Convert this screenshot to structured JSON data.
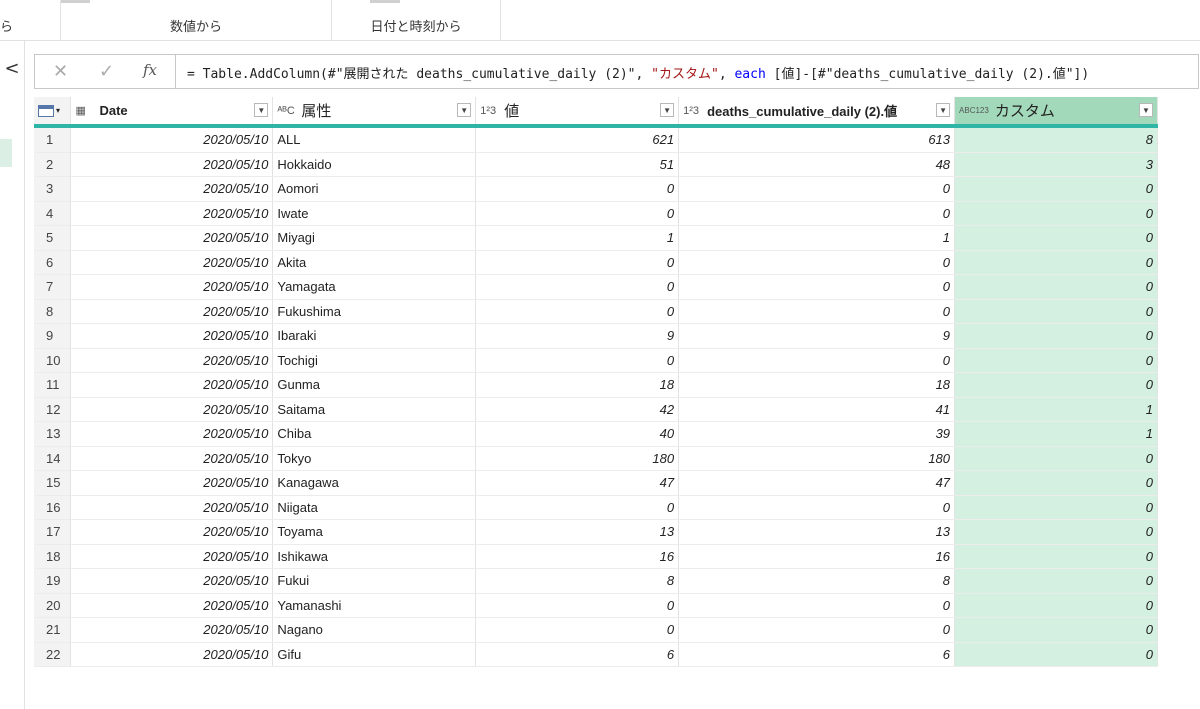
{
  "ribbon": {
    "left_fragment": "ら",
    "groups": [
      "数値から",
      "日付と時刻から"
    ]
  },
  "left_pane": {
    "collapse_glyph": "<"
  },
  "formula_bar": {
    "cancel_glyph": "✕",
    "commit_glyph": "✓",
    "fx_label": "fx",
    "formula": {
      "part1": "= Table.AddColumn(#\"展開された deaths_cumulative_daily (2)\", ",
      "part2": "\"カスタム\"",
      "part3": ", ",
      "part4": "each",
      "part5": " [値]-[#\"deaths_cumulative_daily (2).値\"])"
    }
  },
  "columns": [
    {
      "name": "Date",
      "type_icon": "▦"
    },
    {
      "name": "属性",
      "type_icon": "ᴬᴮC"
    },
    {
      "name": "値",
      "type_icon": "1²3"
    },
    {
      "name": "deaths_cumulative_daily (2).値",
      "type_icon": "1²3"
    },
    {
      "name": "カスタム",
      "type_icon": "ABC123"
    }
  ],
  "rows": [
    [
      "1",
      "2020/05/10",
      "ALL",
      "621",
      "613",
      "8"
    ],
    [
      "2",
      "2020/05/10",
      "Hokkaido",
      "51",
      "48",
      "3"
    ],
    [
      "3",
      "2020/05/10",
      "Aomori",
      "0",
      "0",
      "0"
    ],
    [
      "4",
      "2020/05/10",
      "Iwate",
      "0",
      "0",
      "0"
    ],
    [
      "5",
      "2020/05/10",
      "Miyagi",
      "1",
      "1",
      "0"
    ],
    [
      "6",
      "2020/05/10",
      "Akita",
      "0",
      "0",
      "0"
    ],
    [
      "7",
      "2020/05/10",
      "Yamagata",
      "0",
      "0",
      "0"
    ],
    [
      "8",
      "2020/05/10",
      "Fukushima",
      "0",
      "0",
      "0"
    ],
    [
      "9",
      "2020/05/10",
      "Ibaraki",
      "9",
      "9",
      "0"
    ],
    [
      "10",
      "2020/05/10",
      "Tochigi",
      "0",
      "0",
      "0"
    ],
    [
      "11",
      "2020/05/10",
      "Gunma",
      "18",
      "18",
      "0"
    ],
    [
      "12",
      "2020/05/10",
      "Saitama",
      "42",
      "41",
      "1"
    ],
    [
      "13",
      "2020/05/10",
      "Chiba",
      "40",
      "39",
      "1"
    ],
    [
      "14",
      "2020/05/10",
      "Tokyo",
      "180",
      "180",
      "0"
    ],
    [
      "15",
      "2020/05/10",
      "Kanagawa",
      "47",
      "47",
      "0"
    ],
    [
      "16",
      "2020/05/10",
      "Niigata",
      "0",
      "0",
      "0"
    ],
    [
      "17",
      "2020/05/10",
      "Toyama",
      "13",
      "13",
      "0"
    ],
    [
      "18",
      "2020/05/10",
      "Ishikawa",
      "16",
      "16",
      "0"
    ],
    [
      "19",
      "2020/05/10",
      "Fukui",
      "8",
      "8",
      "0"
    ],
    [
      "20",
      "2020/05/10",
      "Yamanashi",
      "0",
      "0",
      "0"
    ],
    [
      "21",
      "2020/05/10",
      "Nagano",
      "0",
      "0",
      "0"
    ],
    [
      "22",
      "2020/05/10",
      "Gifu",
      "6",
      "6",
      "0"
    ]
  ],
  "colors": {
    "accent_line": "#2fb5a5",
    "custom_col_bg": "#d3f0e0",
    "custom_head_bg": "#a3d9bb"
  }
}
